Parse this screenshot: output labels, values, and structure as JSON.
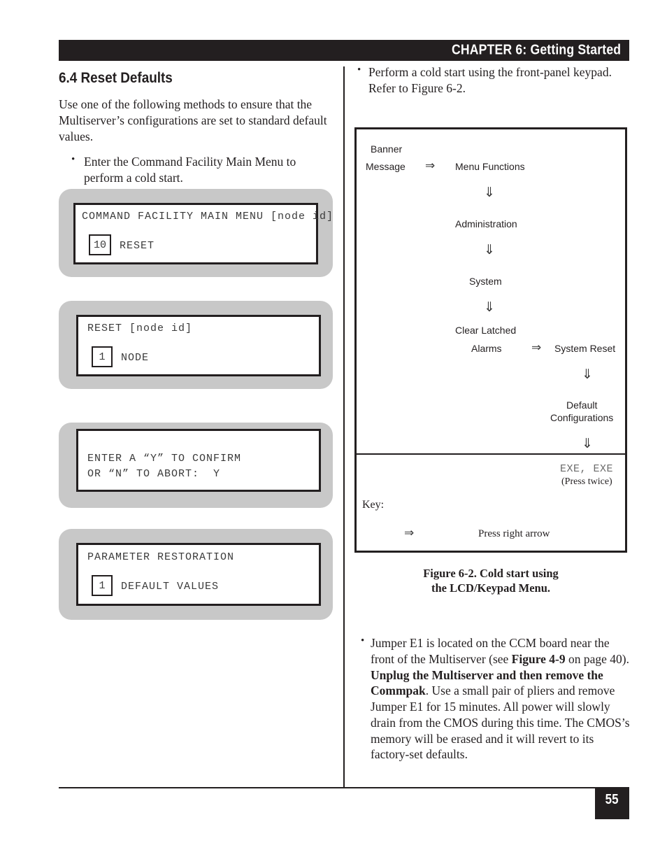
{
  "header": {
    "chapter_title": "CHAPTER 6: Getting Started"
  },
  "footer": {
    "page_number": "55"
  },
  "left_column": {
    "section_number_title": "6.4  Reset Defaults",
    "intro_paragraph": "Use one of the following methods to ensure that the Multiserver’s configurations are set to standard default values.",
    "bullets": [
      "Enter the Command Facility Main Menu to perform a cold start."
    ],
    "lcd_panels": [
      {
        "title_line": "COMMAND FACILITY MAIN MENU [node id]",
        "item_number": "10",
        "item_label": "RESET"
      },
      {
        "title_line": "RESET [node id]",
        "item_number": "1",
        "item_label": "NODE"
      },
      {
        "line1": "ENTER A “Y” TO CONFIRM",
        "line2": "OR “N” TO ABORT:  Y"
      },
      {
        "title_line": "PARAMETER RESTORATION",
        "item_number": "1",
        "item_label": "DEFAULT VALUES"
      }
    ]
  },
  "right_column": {
    "top_bullet": "Perform a cold start using the front-panel keypad. Refer to Figure 6-2.",
    "figure": {
      "nodes": {
        "banner": "Banner",
        "message": "Message",
        "menu_functions": "Menu Functions",
        "administration": "Administration",
        "system": "System",
        "clear_latched": "Clear Latched",
        "alarms": "Alarms",
        "system_reset": "System Reset",
        "default_line1": "Default",
        "default_line2": "Configurations",
        "exe_exe": "EXE, EXE",
        "press_twice": "(Press twice)"
      },
      "key": {
        "label": "Key:",
        "arrow_glyph": "⇒",
        "arrow_meaning": "Press right arrow"
      },
      "down_arrow_glyph": "⇓",
      "right_arrow_glyph": "⇒"
    },
    "figure_caption_line1": "Figure 6-2. Cold start using",
    "figure_caption_line2": "the LCD/Keypad Menu.",
    "jumper_paragraph": {
      "part1": "Jumper E1 is located on the CCM board near the front of the Multiserver (see ",
      "bold1": "Figure 4-9",
      "part2": " on page 40). ",
      "bold2": "Unplug the Multiserver and then remove the Commpak",
      "part3": ". Use a small pair of pliers and remove Jumper E1 for 15 minutes. All power will slowly drain from the CMOS during this time. The CMOS’s memory will be erased and it will revert to its factory-set defaults."
    }
  },
  "colors": {
    "ink": "#231f20",
    "lcd_bezel": "#c8c8c8",
    "lcd_screen": "#ffffff"
  }
}
